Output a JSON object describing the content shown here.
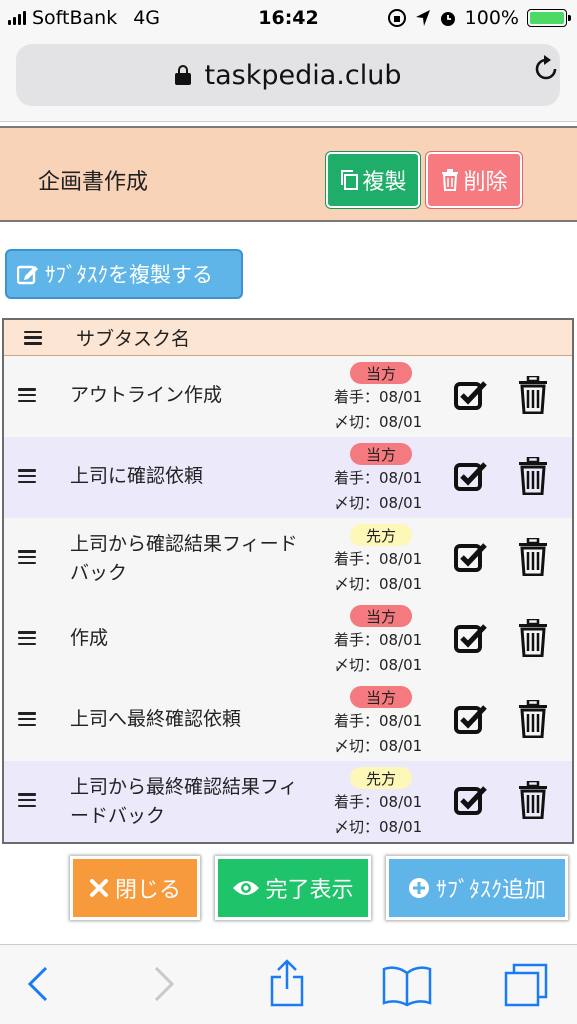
{
  "status_bar": {
    "carrier": "SoftBank",
    "network": "4G",
    "time": "16:42",
    "battery": "100%",
    "battery_level": 1.0
  },
  "browser": {
    "url": "taskpedia.club",
    "icons": [
      "lock-icon",
      "reload-icon"
    ]
  },
  "task": {
    "title": "企画書作成",
    "copy_label": "複製",
    "delete_label": "削除",
    "colors": {
      "header_bg": "#f8d3b8",
      "copy": "#1fae6a",
      "delete": "#f77a80"
    }
  },
  "duplicate_button": {
    "label": "ｻﾌﾞﾀｽｸを複製する"
  },
  "table": {
    "column_header": "サブタスク名",
    "rows": [
      {
        "name": "アウトライン作成",
        "badge": "当方",
        "badge_color": "#f47a7f",
        "start": "着手：08/01",
        "due": "〆切：08/01"
      },
      {
        "name": "上司に確認依頼",
        "badge": "当方",
        "badge_color": "#f47a7f",
        "start": "着手：08/01",
        "due": "〆切：08/01"
      },
      {
        "name": "上司から確認結果フィードバック",
        "badge": "先方",
        "badge_color": "#fdf7b8",
        "start": "着手：08/01",
        "due": "〆切：08/01"
      },
      {
        "name": "作成",
        "badge": "当方",
        "badge_color": "#f47a7f",
        "start": "着手：08/01",
        "due": "〆切：08/01"
      },
      {
        "name": "上司へ最終確認依頼",
        "badge": "当方",
        "badge_color": "#f47a7f",
        "start": "着手：08/01",
        "due": "〆切：08/01"
      },
      {
        "name": "上司から最終確認結果フィードバック",
        "badge": "先方",
        "badge_color": "#fdf7b8",
        "start": "着手：08/01",
        "due": "〆切：08/01"
      }
    ]
  },
  "footer_buttons": {
    "close": "閉じる",
    "show_done": "完了表示",
    "add_subtask": "ｻﾌﾞﾀｽｸ追加",
    "colors": {
      "close": "#f79a3c",
      "show_done": "#1fc36a",
      "add_subtask": "#5fb4e8"
    }
  },
  "toolbar": {
    "icons": [
      "back-icon",
      "forward-icon",
      "share-icon",
      "bookmarks-icon",
      "tabs-icon"
    ]
  }
}
